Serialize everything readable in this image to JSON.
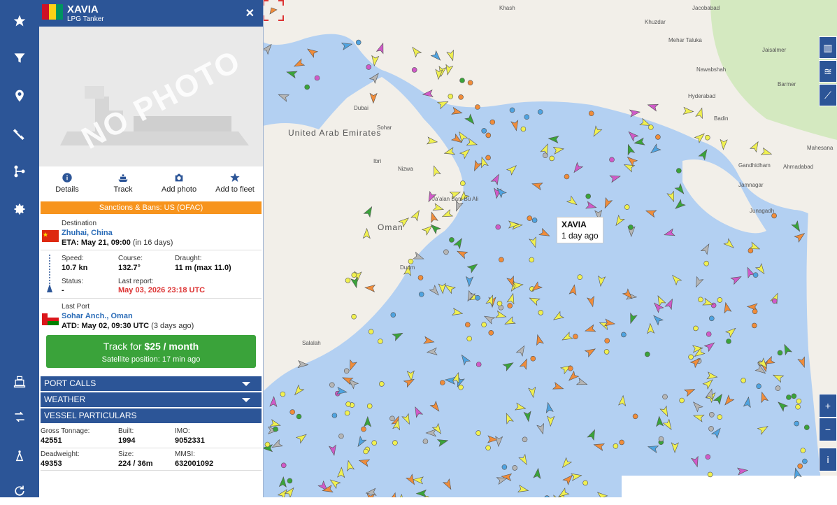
{
  "rail": {
    "items": [
      "star-icon",
      "filter-icon",
      "pin-icon",
      "satellite-icon",
      "route-icon",
      "gear-icon",
      "port-icon",
      "exchange-icon",
      "antenna-icon",
      "refresh-icon"
    ]
  },
  "vessel": {
    "name": "XAVIA",
    "type": "LPG Tanker",
    "photo_placeholder": "NO PHOTO",
    "actions": [
      "Details",
      "Track",
      "Add photo",
      "Add to fleet"
    ],
    "sanctions": "Sanctions & Bans: US (OFAC)",
    "destination_label": "Destination",
    "destination": "Zhuhai, China",
    "eta_label": "ETA: May 21, 09:00",
    "eta_rel": "(in 16 days)",
    "speed_label": "Speed:",
    "speed": "10.7 kn",
    "course_label": "Course:",
    "course": "132.7°",
    "draught_label": "Draught:",
    "draught": "11 m (max 11.0)",
    "status_label": "Status:",
    "status": "-",
    "last_report_label": "Last report:",
    "last_report": "May 03, 2026 23:18 UTC",
    "last_port_label": "Last Port",
    "last_port": "Sohar Anch., Oman",
    "atd_label": "ATD: May 02, 09:30 UTC",
    "atd_rel": "(3 days ago)",
    "track_price_prefix": "Track for",
    "track_price": "$25 / month",
    "track_sub": "Satellite position: 17 min ago",
    "sections": [
      "PORT CALLS",
      "WEATHER",
      "VESSEL PARTICULARS"
    ],
    "particulars": {
      "gross_tonnage_label": "Gross Tonnage:",
      "gross_tonnage": "42551",
      "built_label": "Built:",
      "built": "1994",
      "imo_label": "IMO:",
      "imo": "9052331",
      "deadweight_label": "Deadweight:",
      "deadweight": "49353",
      "size_label": "Size:",
      "size": "224 / 36m",
      "mmsi_label": "MMSI:",
      "mmsi": "632001092"
    }
  },
  "map": {
    "tooltip_name": "XAVIA",
    "tooltip_time": "1 day ago",
    "labels": [
      "United Arab Emirates",
      "Oman",
      "Khash",
      "Ahmadabad",
      "Jacobabad",
      "Khuzdar",
      "Mehar Taluka",
      "Nawabshah",
      "Hyderabad",
      "Badin",
      "Gandhidham",
      "Jamnagar",
      "Junagadh",
      "Mahesana",
      "Jaisalmer",
      "Barmer",
      "Ibri",
      "Nizwa",
      "Sohar",
      "Dubai",
      "Duqm",
      "Salalah",
      "Ja'alan Bani Bu Ali"
    ],
    "controls": [
      "+",
      "−",
      "i"
    ],
    "colors": {
      "water": "#b3d0f2",
      "land": "#f2efe9",
      "green_land": "#d4e9c0",
      "yellow": "#f0f050",
      "orange": "#f08c3a",
      "blue": "#4fa3e0",
      "gray": "#b5b5b5",
      "pink": "#d05ac8",
      "green": "#3aa33a"
    }
  }
}
